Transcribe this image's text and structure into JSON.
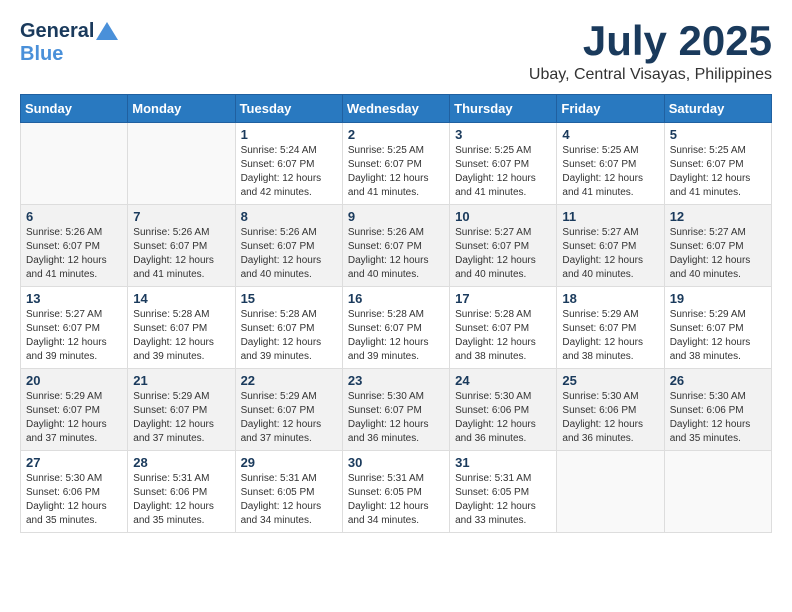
{
  "header": {
    "logo_general": "General",
    "logo_blue": "Blue",
    "title": "July 2025",
    "subtitle": "Ubay, Central Visayas, Philippines"
  },
  "weekdays": [
    "Sunday",
    "Monday",
    "Tuesday",
    "Wednesday",
    "Thursday",
    "Friday",
    "Saturday"
  ],
  "weeks": [
    [
      {
        "day": "",
        "info": ""
      },
      {
        "day": "",
        "info": ""
      },
      {
        "day": "1",
        "info": "Sunrise: 5:24 AM\nSunset: 6:07 PM\nDaylight: 12 hours and 42 minutes."
      },
      {
        "day": "2",
        "info": "Sunrise: 5:25 AM\nSunset: 6:07 PM\nDaylight: 12 hours and 41 minutes."
      },
      {
        "day": "3",
        "info": "Sunrise: 5:25 AM\nSunset: 6:07 PM\nDaylight: 12 hours and 41 minutes."
      },
      {
        "day": "4",
        "info": "Sunrise: 5:25 AM\nSunset: 6:07 PM\nDaylight: 12 hours and 41 minutes."
      },
      {
        "day": "5",
        "info": "Sunrise: 5:25 AM\nSunset: 6:07 PM\nDaylight: 12 hours and 41 minutes."
      }
    ],
    [
      {
        "day": "6",
        "info": "Sunrise: 5:26 AM\nSunset: 6:07 PM\nDaylight: 12 hours and 41 minutes."
      },
      {
        "day": "7",
        "info": "Sunrise: 5:26 AM\nSunset: 6:07 PM\nDaylight: 12 hours and 41 minutes."
      },
      {
        "day": "8",
        "info": "Sunrise: 5:26 AM\nSunset: 6:07 PM\nDaylight: 12 hours and 40 minutes."
      },
      {
        "day": "9",
        "info": "Sunrise: 5:26 AM\nSunset: 6:07 PM\nDaylight: 12 hours and 40 minutes."
      },
      {
        "day": "10",
        "info": "Sunrise: 5:27 AM\nSunset: 6:07 PM\nDaylight: 12 hours and 40 minutes."
      },
      {
        "day": "11",
        "info": "Sunrise: 5:27 AM\nSunset: 6:07 PM\nDaylight: 12 hours and 40 minutes."
      },
      {
        "day": "12",
        "info": "Sunrise: 5:27 AM\nSunset: 6:07 PM\nDaylight: 12 hours and 40 minutes."
      }
    ],
    [
      {
        "day": "13",
        "info": "Sunrise: 5:27 AM\nSunset: 6:07 PM\nDaylight: 12 hours and 39 minutes."
      },
      {
        "day": "14",
        "info": "Sunrise: 5:28 AM\nSunset: 6:07 PM\nDaylight: 12 hours and 39 minutes."
      },
      {
        "day": "15",
        "info": "Sunrise: 5:28 AM\nSunset: 6:07 PM\nDaylight: 12 hours and 39 minutes."
      },
      {
        "day": "16",
        "info": "Sunrise: 5:28 AM\nSunset: 6:07 PM\nDaylight: 12 hours and 39 minutes."
      },
      {
        "day": "17",
        "info": "Sunrise: 5:28 AM\nSunset: 6:07 PM\nDaylight: 12 hours and 38 minutes."
      },
      {
        "day": "18",
        "info": "Sunrise: 5:29 AM\nSunset: 6:07 PM\nDaylight: 12 hours and 38 minutes."
      },
      {
        "day": "19",
        "info": "Sunrise: 5:29 AM\nSunset: 6:07 PM\nDaylight: 12 hours and 38 minutes."
      }
    ],
    [
      {
        "day": "20",
        "info": "Sunrise: 5:29 AM\nSunset: 6:07 PM\nDaylight: 12 hours and 37 minutes."
      },
      {
        "day": "21",
        "info": "Sunrise: 5:29 AM\nSunset: 6:07 PM\nDaylight: 12 hours and 37 minutes."
      },
      {
        "day": "22",
        "info": "Sunrise: 5:29 AM\nSunset: 6:07 PM\nDaylight: 12 hours and 37 minutes."
      },
      {
        "day": "23",
        "info": "Sunrise: 5:30 AM\nSunset: 6:07 PM\nDaylight: 12 hours and 36 minutes."
      },
      {
        "day": "24",
        "info": "Sunrise: 5:30 AM\nSunset: 6:06 PM\nDaylight: 12 hours and 36 minutes."
      },
      {
        "day": "25",
        "info": "Sunrise: 5:30 AM\nSunset: 6:06 PM\nDaylight: 12 hours and 36 minutes."
      },
      {
        "day": "26",
        "info": "Sunrise: 5:30 AM\nSunset: 6:06 PM\nDaylight: 12 hours and 35 minutes."
      }
    ],
    [
      {
        "day": "27",
        "info": "Sunrise: 5:30 AM\nSunset: 6:06 PM\nDaylight: 12 hours and 35 minutes."
      },
      {
        "day": "28",
        "info": "Sunrise: 5:31 AM\nSunset: 6:06 PM\nDaylight: 12 hours and 35 minutes."
      },
      {
        "day": "29",
        "info": "Sunrise: 5:31 AM\nSunset: 6:05 PM\nDaylight: 12 hours and 34 minutes."
      },
      {
        "day": "30",
        "info": "Sunrise: 5:31 AM\nSunset: 6:05 PM\nDaylight: 12 hours and 34 minutes."
      },
      {
        "day": "31",
        "info": "Sunrise: 5:31 AM\nSunset: 6:05 PM\nDaylight: 12 hours and 33 minutes."
      },
      {
        "day": "",
        "info": ""
      },
      {
        "day": "",
        "info": ""
      }
    ]
  ]
}
